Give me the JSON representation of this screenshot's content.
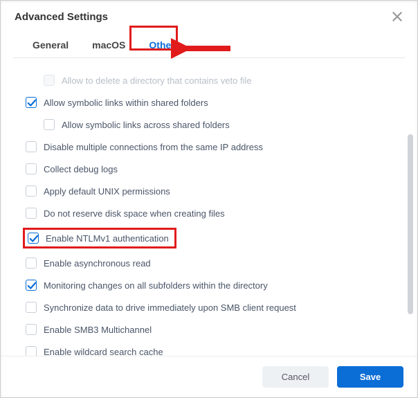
{
  "dialog": {
    "title": "Advanced Settings"
  },
  "tabs": {
    "items": [
      {
        "id": "general",
        "label": "General",
        "active": false
      },
      {
        "id": "macos",
        "label": "macOS",
        "active": false
      },
      {
        "id": "others",
        "label": "Others",
        "active": true
      }
    ]
  },
  "options": [
    {
      "id": "veto",
      "label": "Allow to delete a directory that contains veto file",
      "checked": false,
      "disabled": true,
      "indent": true
    },
    {
      "id": "symlinks",
      "label": "Allow symbolic links within shared folders",
      "checked": true,
      "disabled": false,
      "indent": false
    },
    {
      "id": "symlinks-x",
      "label": "Allow symbolic links across shared folders",
      "checked": false,
      "disabled": false,
      "indent": true
    },
    {
      "id": "multi-ip",
      "label": "Disable multiple connections from the same IP address",
      "checked": false,
      "disabled": false,
      "indent": false
    },
    {
      "id": "debug-logs",
      "label": "Collect debug logs",
      "checked": false,
      "disabled": false,
      "indent": false
    },
    {
      "id": "unix-perms",
      "label": "Apply default UNIX permissions",
      "checked": false,
      "disabled": false,
      "indent": false
    },
    {
      "id": "no-reserve",
      "label": "Do not reserve disk space when creating files",
      "checked": false,
      "disabled": false,
      "indent": false
    },
    {
      "id": "ntlmv1",
      "label": "Enable NTLMv1 authentication",
      "checked": true,
      "disabled": false,
      "indent": false,
      "highlighted": true
    },
    {
      "id": "async-read",
      "label": "Enable asynchronous read",
      "checked": false,
      "disabled": false,
      "indent": false
    },
    {
      "id": "monitor",
      "label": "Monitoring changes on all subfolders within the directory",
      "checked": true,
      "disabled": false,
      "indent": false
    },
    {
      "id": "sync-smb",
      "label": "Synchronize data to drive immediately upon SMB client request",
      "checked": false,
      "disabled": false,
      "indent": false
    },
    {
      "id": "smb3-multi",
      "label": "Enable SMB3 Multichannel",
      "checked": false,
      "disabled": false,
      "indent": false
    },
    {
      "id": "wildcard",
      "label": "Enable wildcard search cache",
      "checked": false,
      "disabled": false,
      "indent": false
    }
  ],
  "footer": {
    "cancel": "Cancel",
    "save": "Save"
  },
  "annotation": {
    "arrow_color": "#e11b1b"
  }
}
